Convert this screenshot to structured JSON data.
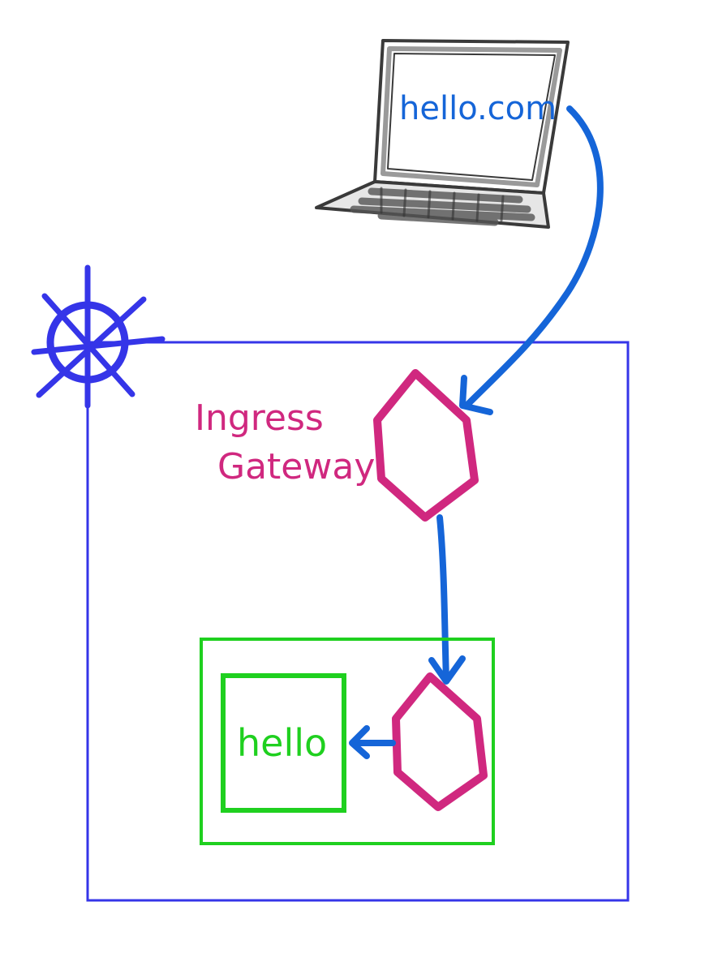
{
  "laptop": {
    "screen_text": "hello.com"
  },
  "ingress_gateway": {
    "label_line1": "Ingress",
    "label_line2": "Gateway"
  },
  "service": {
    "label": "hello"
  },
  "colors": {
    "cluster": "#3535e8",
    "ingress": "#d0287f",
    "sidecar": "#d0287f",
    "pod": "#1fd01f",
    "arrow": "#1565d8",
    "laptop": "#3a3a3a",
    "laptop_screen_bezel": "#9a9a9a",
    "keyboard": "#555555"
  },
  "icons": {
    "cluster_logo": "helm-wheel-icon",
    "client_device": "laptop-icon",
    "gateway_proxy": "hexagon-icon",
    "sidecar_proxy": "hexagon-icon"
  }
}
